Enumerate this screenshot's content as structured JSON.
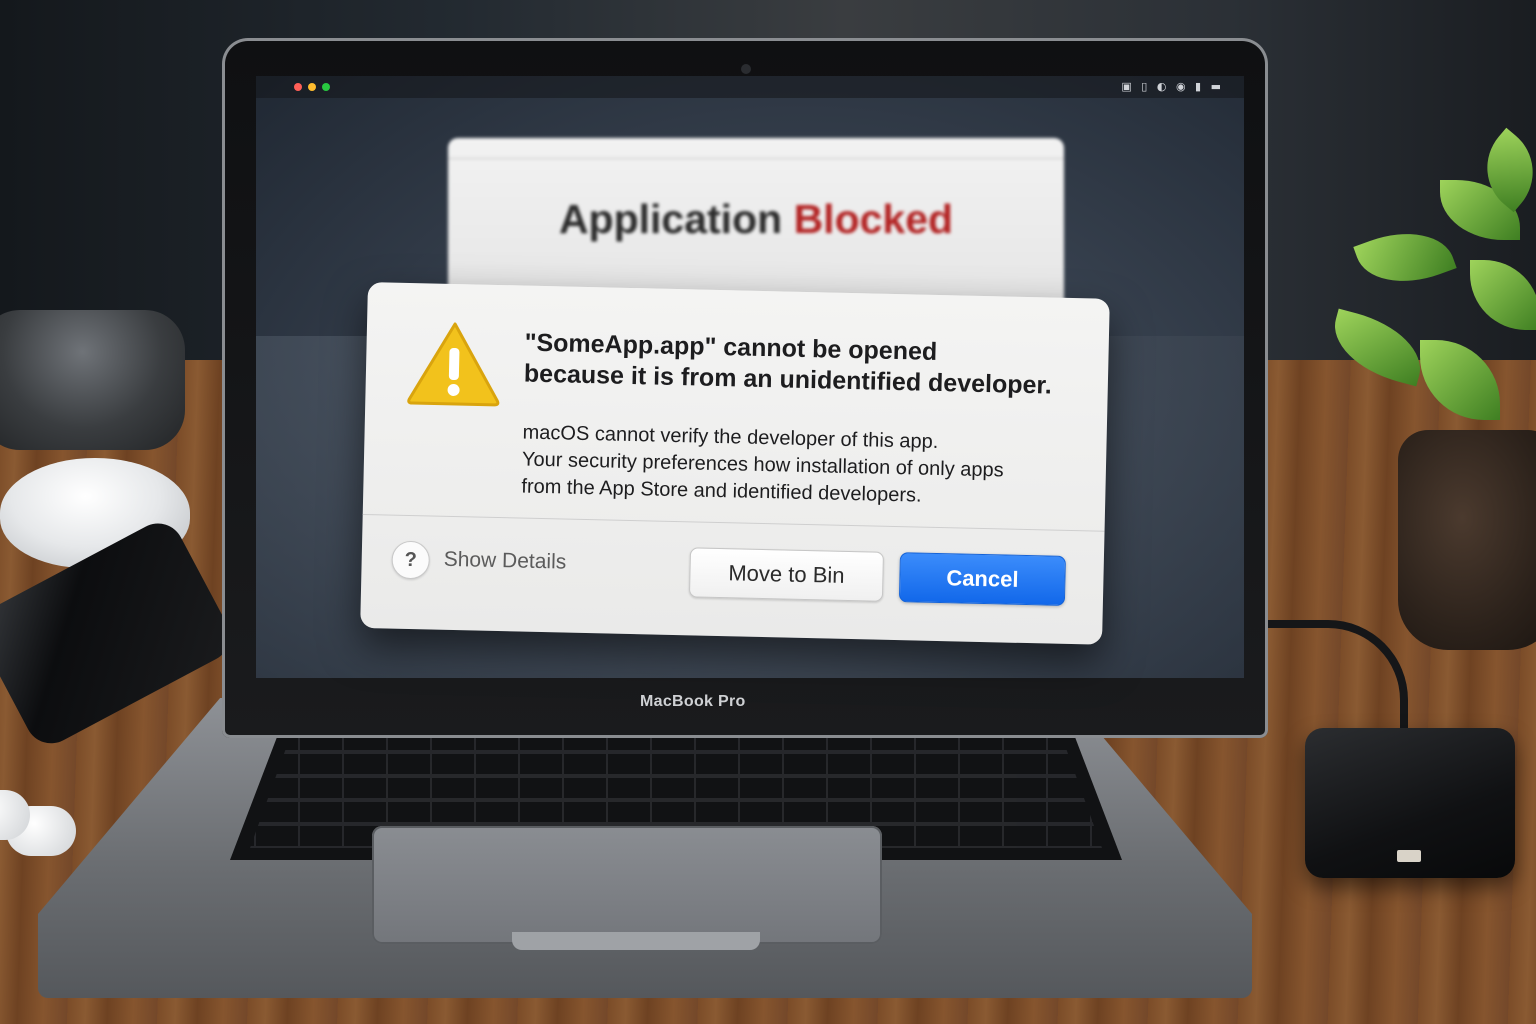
{
  "device": {
    "model_label": "MacBook Pro"
  },
  "background_window": {
    "heading_part1": "Application",
    "heading_part2": "Blocked"
  },
  "dialog": {
    "title_line1": "\"SomeApp.app\" cannot be opened",
    "title_line2": "because it is from an unidentified developer.",
    "body_line1": "macOS cannot verify the developer of this app.",
    "body_line2": "Your security preferences how installation of only apps",
    "body_line3": "from the App Store and identified developers.",
    "help_button": "?",
    "show_details": "Show Details",
    "move_to_bin": "Move to Bin",
    "cancel": "Cancel",
    "icon": "warning-icon"
  },
  "colors": {
    "accent": "#1a6ef0",
    "warning": "#f2c21c",
    "blocked_red": "#b32424"
  }
}
